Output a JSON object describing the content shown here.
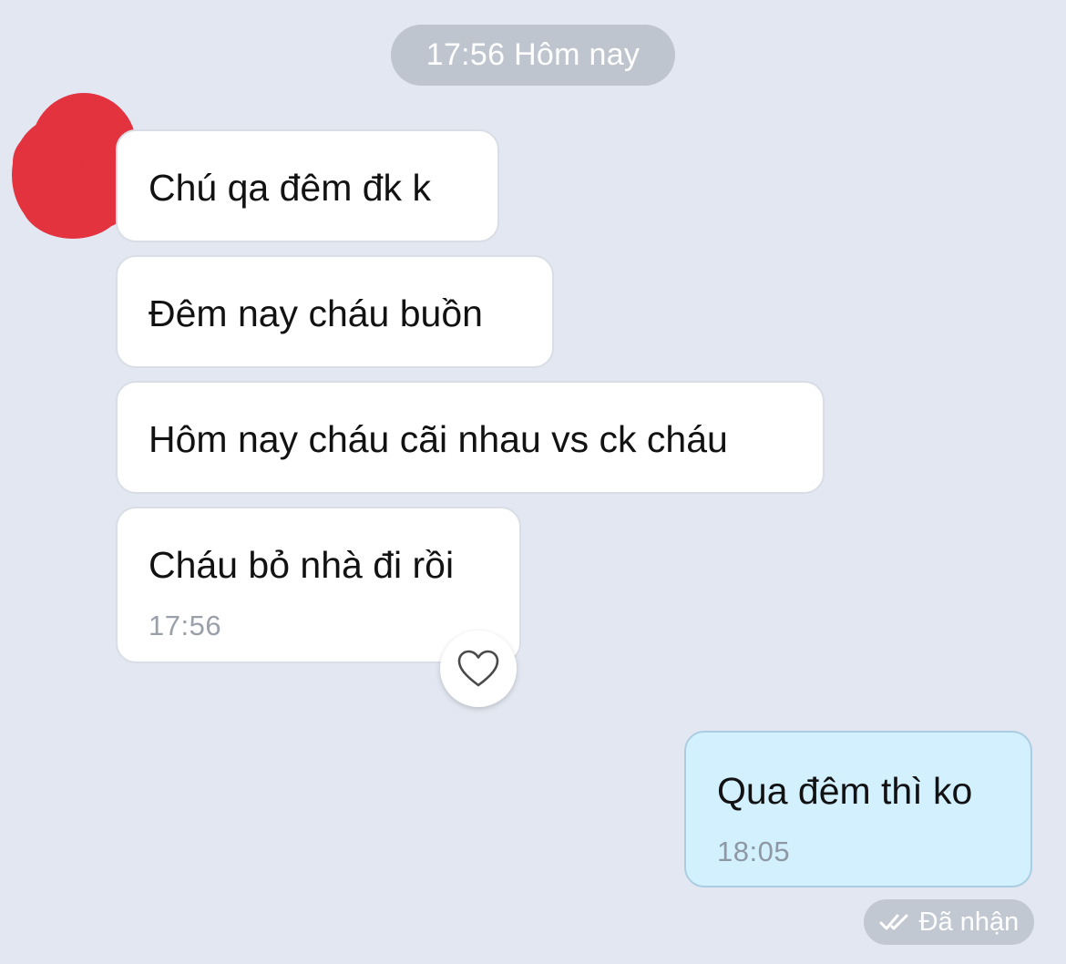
{
  "time_separator": "17:56 Hôm nay",
  "incoming_messages": [
    {
      "text": "Chú qa đêm đk k"
    },
    {
      "text": "Đêm nay cháu buồn"
    },
    {
      "text": "Hôm nay cháu cãi nhau vs ck cháu"
    },
    {
      "text": "Cháu bỏ nhà đi rồi",
      "time": "17:56"
    }
  ],
  "outgoing_message": {
    "text": "Qua đêm thì ko",
    "time": "18:05"
  },
  "receipt": {
    "icon": "double-check-icon",
    "label": "Đã nhận"
  },
  "react_button": {
    "icon": "heart-outline-icon"
  },
  "avatar": {
    "appearance": "redacted with red scribble"
  },
  "colors": {
    "background": "#e2e7f1",
    "incoming_bubble": "#ffffff",
    "outgoing_bubble": "#d3f0ff",
    "redaction": "#e2333f",
    "pill": "#bfc5cf"
  }
}
